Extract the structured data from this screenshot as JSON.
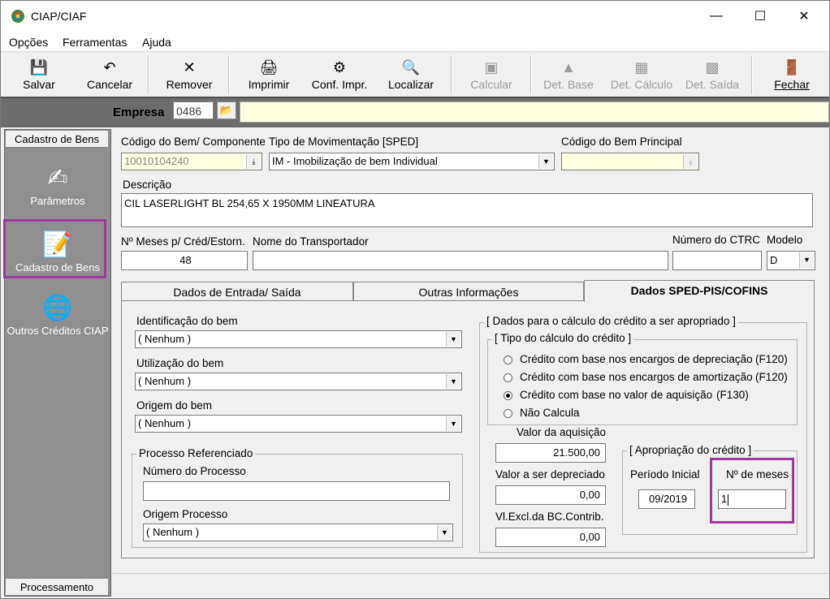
{
  "window": {
    "title": "CIAP/CIAF"
  },
  "menu": [
    "Opções",
    "Ferramentas",
    "Ajuda"
  ],
  "toolbar": {
    "salvar": "Salvar",
    "cancelar": "Cancelar",
    "remover": "Remover",
    "imprimir": "Imprimir",
    "conf_impr": "Conf. Impr.",
    "localizar": "Localizar",
    "calcular": "Calcular",
    "det_base": "Det. Base",
    "det_calculo": "Det. Cálculo",
    "det_saida": "Det. Saída",
    "fechar": "Fechar"
  },
  "empresa": {
    "label": "Empresa",
    "value": "0486"
  },
  "sidebar": {
    "header": "Cadastro de Bens",
    "items": [
      "Parâmetros",
      "Cadastro de Bens",
      "Outros Créditos CIAP"
    ],
    "footer": "Processamento"
  },
  "form": {
    "codigo_bem_label": "Código do Bem/ Componente",
    "codigo_bem_value": "10010104240",
    "tipo_mov_label": "Tipo de Movimentação [SPED]",
    "tipo_mov_value": "IM - Imobilização de bem Individual",
    "codigo_principal_label": "Código do Bem Principal",
    "codigo_principal_value": "",
    "descricao_label": "Descrição",
    "descricao_value": "CIL LASERLIGHT BL 254,65 X 1950MM LINEATURA",
    "meses_label": "Nº Meses p/ Créd/Estorn.",
    "meses_value": "48",
    "transportador_label": "Nome do Transportador",
    "transportador_value": "",
    "ctrc_label": "Número do CTRC",
    "ctrc_value": "",
    "modelo_label": "Modelo",
    "modelo_value": "D"
  },
  "tabs": [
    "Dados de Entrada/ Saída",
    "Outras Informações",
    "Dados SPED-PIS/COFINS"
  ],
  "sped": {
    "identificacao_label": "Identificação do bem",
    "identificacao_value": "( Nenhum )",
    "utilizacao_label": "Utilização do bem",
    "utilizacao_value": "( Nenhum )",
    "origem_label": "Origem do bem",
    "origem_value": "( Nenhum )",
    "processo_group": "Processo Referenciado",
    "num_processo_label": "Número do Processo",
    "num_processo_value": "",
    "origem_processo_label": "Origem Processo",
    "origem_processo_value": "( Nenhum )",
    "calc_group": "[ Dados para o cálculo do crédito a ser apropriado ]",
    "tipo_group": "[ Tipo do cálculo do crédito ]",
    "radios": [
      {
        "label": "Crédito com base nos encargos de depreciação",
        "code": "(F120)",
        "checked": false
      },
      {
        "label": "Crédito com base nos encargos de amortização",
        "code": "(F120)",
        "checked": false
      },
      {
        "label": "Crédito com base no valor de aquisição",
        "code": "(F130)",
        "checked": true
      },
      {
        "label": "Não Calcula",
        "code": "",
        "checked": false
      }
    ],
    "valor_aquisicao_label": "Valor da aquisição",
    "valor_aquisicao_value": "21.500,00",
    "valor_depreciado_label": "Valor a ser depreciado",
    "valor_depreciado_value": "0,00",
    "vl_excl_label": "Vl.Excl.da BC.Contrib.",
    "vl_excl_value": "0,00",
    "apropriacao_group": "[ Apropriação do crédito ]",
    "periodo_label": "Período Inicial",
    "periodo_value": "09/2019",
    "nmeses_label": "Nº de meses",
    "nmeses_value": "1"
  }
}
